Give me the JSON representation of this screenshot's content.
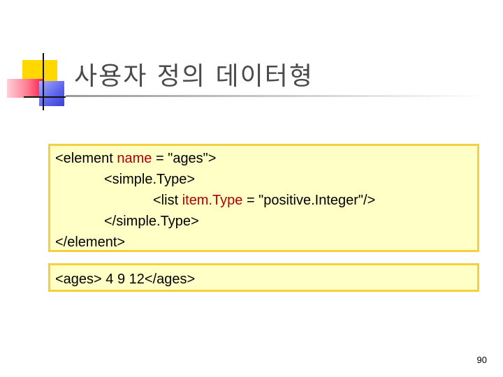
{
  "slide": {
    "title": "사용자 정의 데이터형",
    "page_number": "90"
  },
  "colors": {
    "code_background": "#ffffc6",
    "code_border": "#f4d03f",
    "attribute_name": "#b30000",
    "title_text": "#4a4a4a"
  },
  "definition_box": {
    "line1": {
      "open": "<element ",
      "attr": "name",
      "rest": " = \"ages\">"
    },
    "line2": {
      "text": "<simple.Type>"
    },
    "line3": {
      "open": "<list ",
      "attr": "item.Type",
      "rest": " = \"positive.Integer\"/>"
    },
    "line4": {
      "text": "</simple.Type>"
    },
    "line5": {
      "text": "</element>"
    }
  },
  "instance_box": {
    "text": "<ages> 4 9 12</ages>"
  }
}
